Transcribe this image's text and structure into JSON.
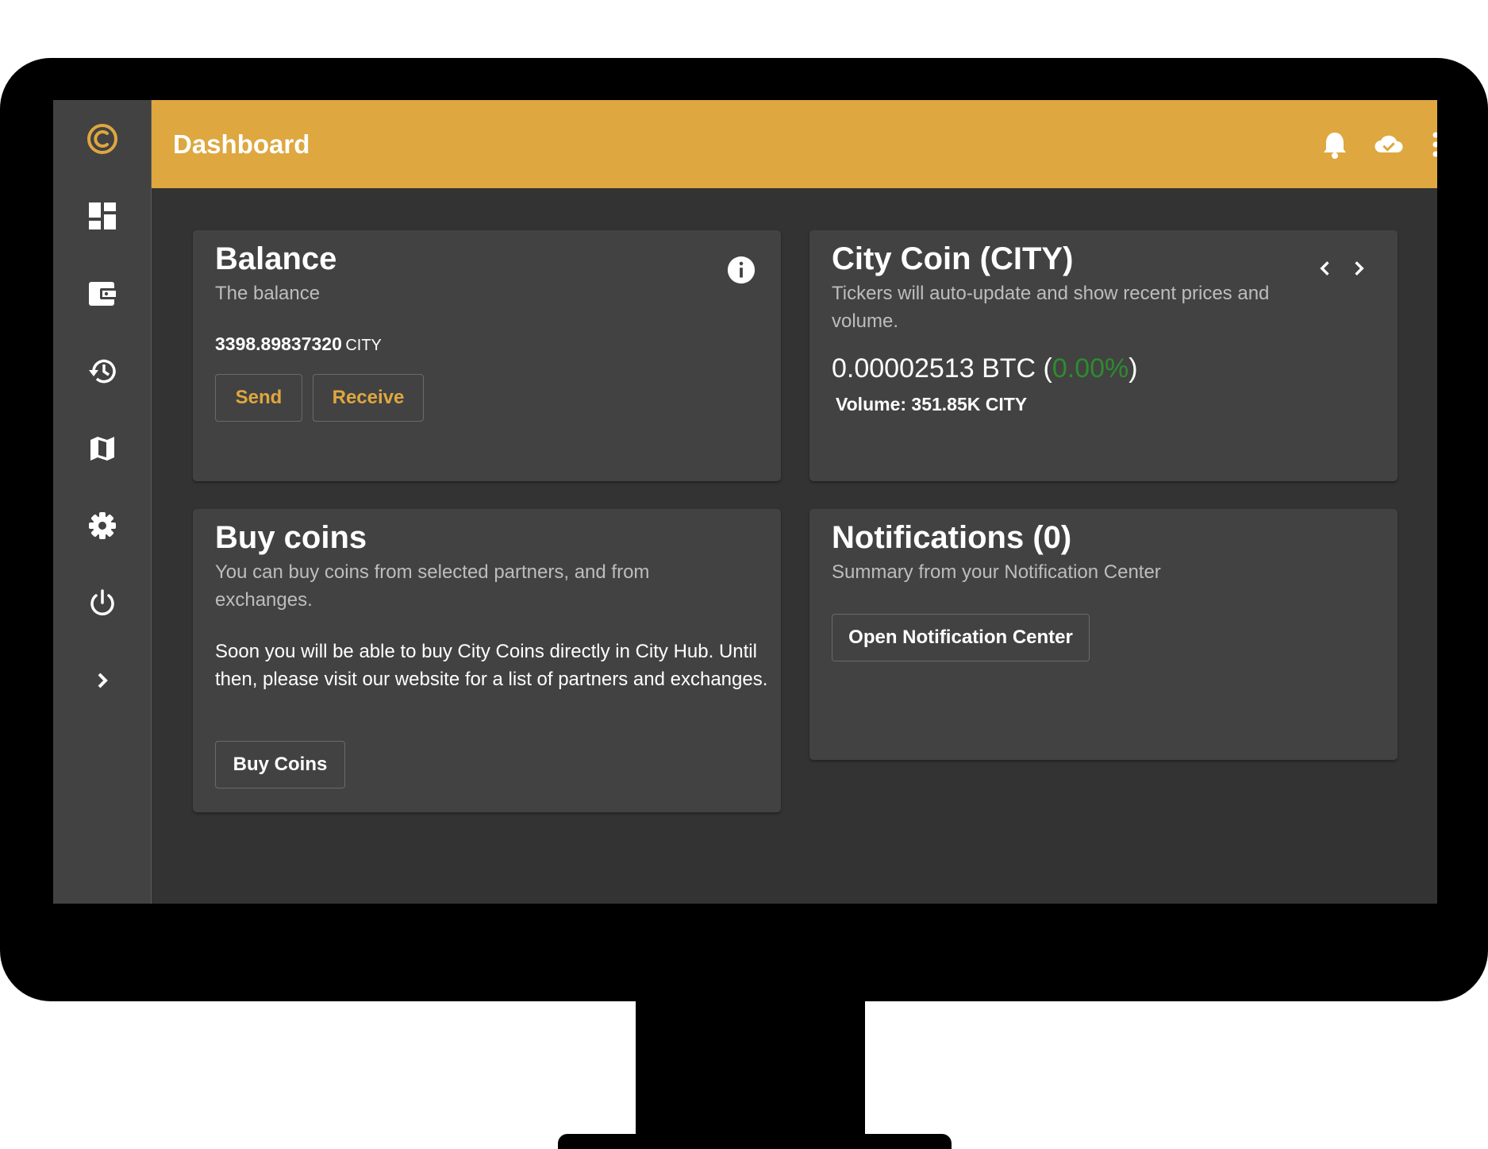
{
  "app": {
    "page_title": "Dashboard",
    "accent_color": "#dea73f",
    "positive_color": "#2e8b2e"
  },
  "sidebar": {
    "items": [
      {
        "icon": "city-logo-icon"
      },
      {
        "icon": "dashboard-icon"
      },
      {
        "icon": "wallet-icon"
      },
      {
        "icon": "history-icon"
      },
      {
        "icon": "map-icon"
      },
      {
        "icon": "settings-icon"
      },
      {
        "icon": "power-icon"
      },
      {
        "icon": "chevron-right-icon"
      }
    ]
  },
  "header": {
    "actions": [
      "bell-icon",
      "cloud-check-icon",
      "more-vertical-icon"
    ]
  },
  "balance": {
    "title": "Balance",
    "subtitle": "The balance",
    "amount": "3398.89837320",
    "unit": "CITY",
    "send_label": "Send",
    "receive_label": "Receive",
    "info_icon": "info-icon"
  },
  "ticker": {
    "title": "City Coin (CITY)",
    "subtitle": "Tickers will auto-update and show recent prices and volume.",
    "price": "0.00002513 BTC (",
    "change": "0.00%",
    "close_paren": ")",
    "volume": "Volume: 351.85K CITY"
  },
  "buy": {
    "title": "Buy coins",
    "subtitle": "You can buy coins from selected partners, and from exchanges.",
    "body": "Soon you will be able to buy City Coins directly in City Hub. Until then, please visit our website for a list of partners and exchanges.",
    "button_label": "Buy Coins"
  },
  "notifications": {
    "title": "Notifications (0)",
    "subtitle": "Summary from your Notification Center",
    "button_label": "Open Notification Center"
  }
}
